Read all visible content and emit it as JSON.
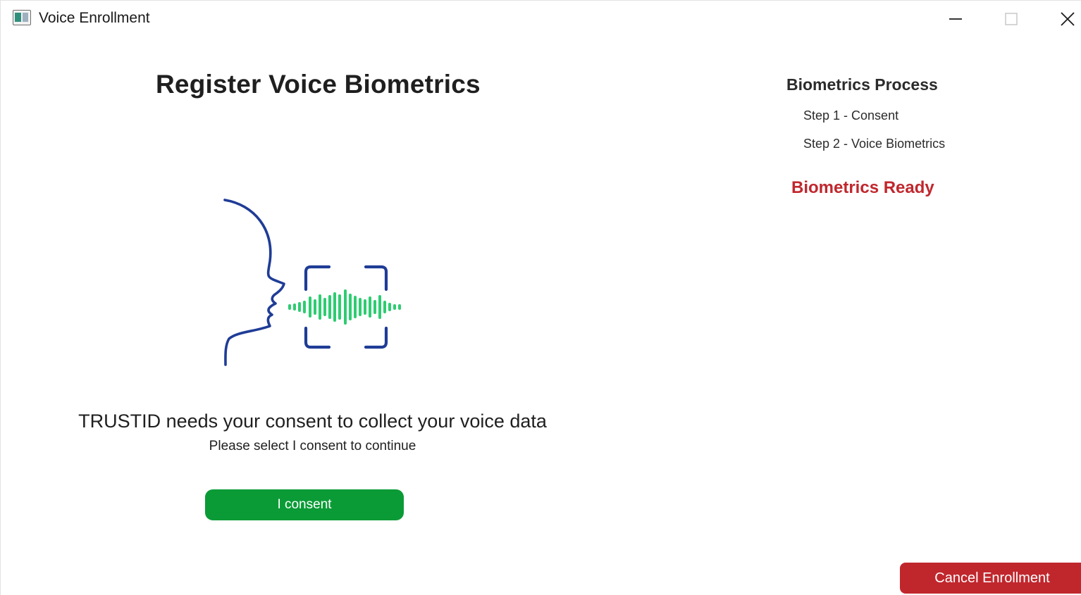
{
  "window": {
    "title": "Voice Enrollment",
    "controls": {
      "minimize_icon": "minimize-icon",
      "maximize_icon": "maximize-icon",
      "close_icon": "close-icon"
    }
  },
  "main": {
    "title": "Register Voice Biometrics",
    "illustration_icon": "voice-biometrics-icon",
    "consent_heading": "TRUSTID needs your consent to collect your voice data",
    "consent_subtext": "Please select I consent to continue",
    "consent_button_label": "I consent"
  },
  "process": {
    "title": "Biometrics Process",
    "steps": [
      {
        "label": "Step 1 - Consent"
      },
      {
        "label": "Step 2 - Voice Biometrics"
      }
    ],
    "status": "Biometrics Ready"
  },
  "footer": {
    "cancel_label": "Cancel Enrollment"
  },
  "colors": {
    "consent_button": "#0a9b36",
    "cancel_button": "#c0272d",
    "status_text": "#c0272d",
    "face_outline": "#1f3c96",
    "sound_wave": "#2ecc71"
  }
}
